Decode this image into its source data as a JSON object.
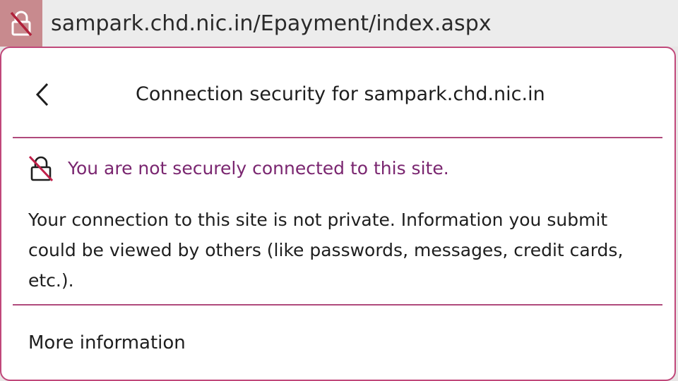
{
  "address_bar": {
    "url": "sampark.chd.nic.in/Epayment/index.aspx",
    "lock_icon": "broken-lock-icon"
  },
  "panel": {
    "back_icon": "chevron-left-icon",
    "title": "Connection security for sampark.chd.nic.in",
    "warning_icon": "broken-lock-icon",
    "warning_text": "You are not securely connected to this site.",
    "description": "Your connection to this site is not private. Information you submit could be viewed by others (like passwords, messages, credit cards, etc.).",
    "more_info_label": "More information"
  },
  "colors": {
    "accent_border": "#c0487a",
    "warning_text": "#7a2670",
    "lock_button_bg": "#c88a8e"
  }
}
